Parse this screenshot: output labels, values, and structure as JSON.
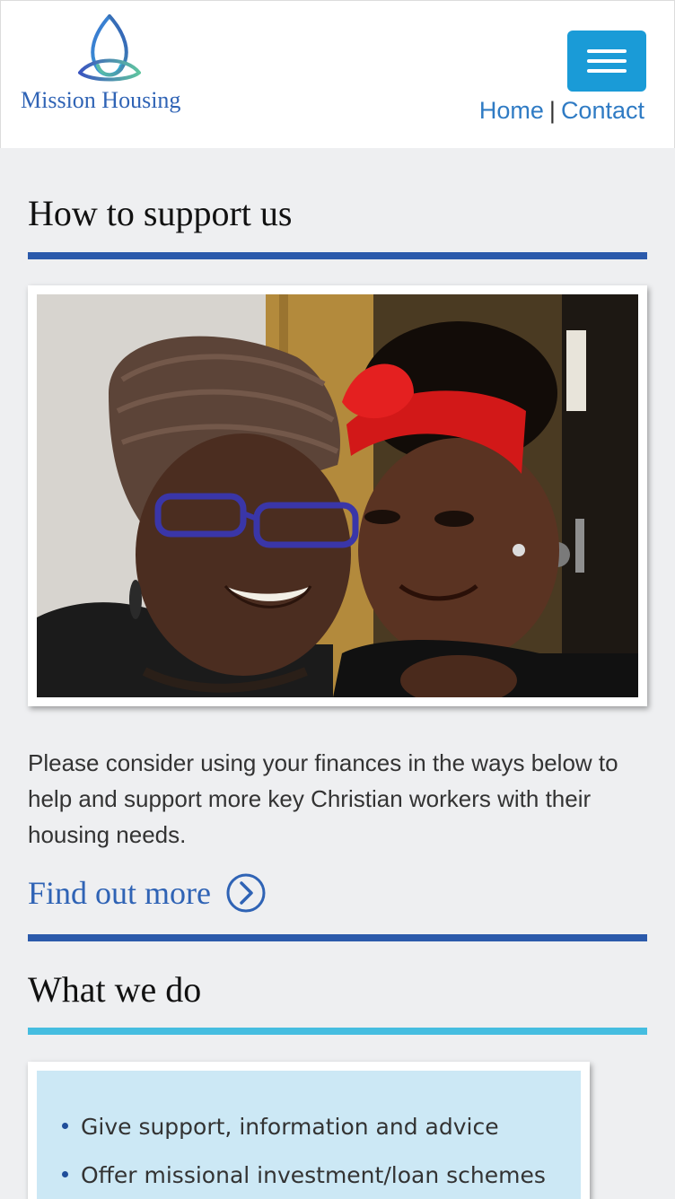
{
  "header": {
    "logo_text": "Mission Housing",
    "nav_home": "Home",
    "nav_separator": "|",
    "nav_contact": "Contact",
    "menu_icon": "hamburger-menu-icon"
  },
  "support_section": {
    "title": "How to support us",
    "image_icon": "photo-mother-and-daughter",
    "description": "Please consider using your finances in the ways below to help and support more key Christian workers with their housing needs.",
    "link_label": "Find out more",
    "link_icon": "chevron-right-circle-icon"
  },
  "what_we_do_section": {
    "title": "What we do",
    "items": [
      "Give support, information and advice",
      "Offer missional investment/loan schemes"
    ]
  },
  "colors": {
    "brand_blue": "#2f63b5",
    "menu_button": "#1a9bd7",
    "rule_dark": "#2b5aab",
    "rule_light": "#45bde0",
    "list_bg": "#cce8f5"
  }
}
